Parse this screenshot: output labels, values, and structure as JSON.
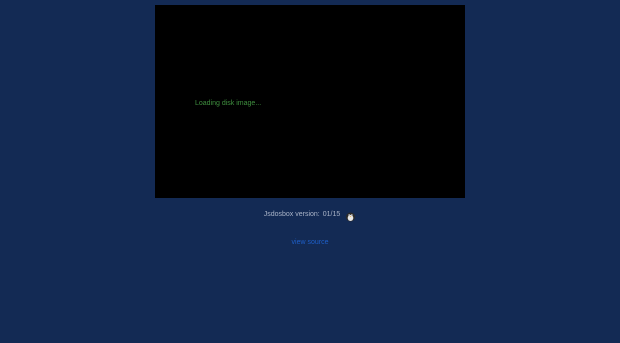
{
  "emulator": {
    "status_text": "Loading disk image..."
  },
  "footer": {
    "version_label": "Jsdosbox version:",
    "version_value": "01/15",
    "link_text": "view source",
    "mascot_icon": "penguin-icon"
  },
  "colors": {
    "page_background": "#132a54",
    "screen_background": "#000000",
    "status_text": "#3f8f3f",
    "link": "#1e5fc8"
  }
}
